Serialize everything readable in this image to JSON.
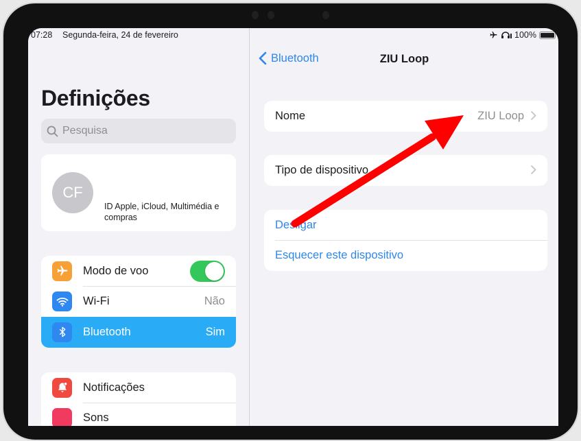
{
  "status_bar": {
    "time": "07:28",
    "date": "Segunda-feira, 24 de fevereiro",
    "battery": "100%",
    "icons": [
      "airplane-icon",
      "headphones-icon",
      "battery-icon"
    ]
  },
  "sidebar": {
    "title": "Definições",
    "search_placeholder": "Pesquisa",
    "profile": {
      "initials": "CF",
      "subtitle": "ID Apple, iCloud, Multimédia e compras"
    },
    "group1": [
      {
        "label": "Modo de voo",
        "icon": "airplane-icon",
        "color": "#f7a035",
        "toggle_on": true
      },
      {
        "label": "Wi-Fi",
        "icon": "wifi-icon",
        "color": "#2f87f0",
        "value": "Não"
      },
      {
        "label": "Bluetooth",
        "icon": "bluetooth-icon",
        "color": "#2f87f0",
        "value": "Sim",
        "selected": true
      }
    ],
    "group2": [
      {
        "label": "Notificações",
        "icon": "bell-icon",
        "color": "#f0493f"
      },
      {
        "label": "Sons",
        "icon": "speaker-icon",
        "color": "#f03a5f"
      }
    ]
  },
  "detail": {
    "back_label": "Bluetooth",
    "title": "ZIU Loop",
    "name_row": {
      "label": "Nome",
      "value": "ZIU Loop"
    },
    "type_row": {
      "label": "Tipo de dispositivo"
    },
    "actions": [
      "Desligar",
      "Esquecer este dispositivo"
    ]
  },
  "colors": {
    "accent": "#2f87e8",
    "selected": "#2aabf6",
    "toggle_on": "#34c759",
    "annotation_arrow": "#ff0000"
  }
}
